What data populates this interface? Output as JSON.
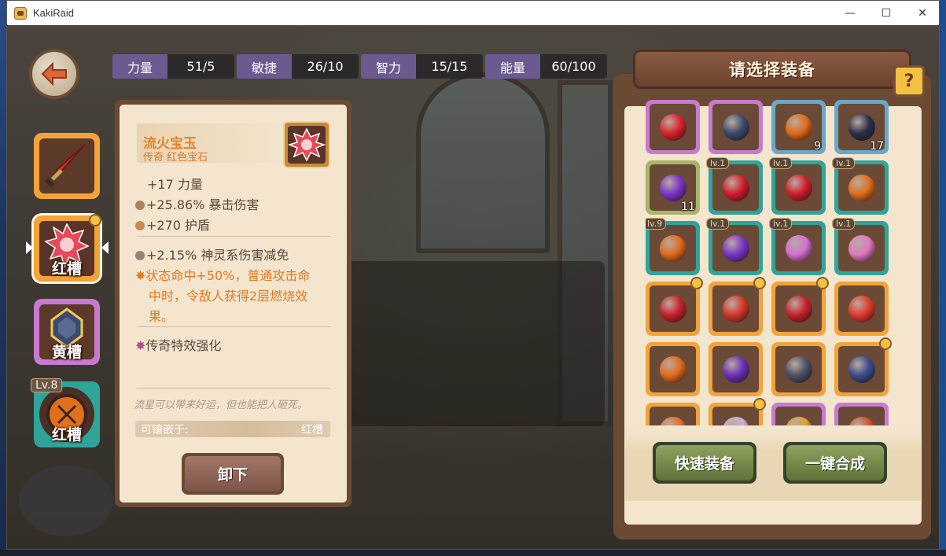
{
  "window": {
    "title": "KakiRaid",
    "minimize": "—",
    "maximize": "☐",
    "close": "✕"
  },
  "stats": [
    {
      "label": "力量",
      "value": "51/5"
    },
    {
      "label": "敏捷",
      "value": "26/10"
    },
    {
      "label": "智力",
      "value": "15/15"
    },
    {
      "label": "能量",
      "value": "60/100"
    }
  ],
  "slots": [
    {
      "label": ""
    },
    {
      "label": "红槽"
    },
    {
      "label": "黄槽"
    },
    {
      "label": "红槽",
      "level": "Lv.8"
    }
  ],
  "detail": {
    "name": "流火宝玉",
    "subtitle": "传奇 红色宝石",
    "stat1": "+17 力量",
    "stat2": "+25.86% 暴击伤害",
    "stat3": "+270 护盾",
    "stat4": "+2.15% 神灵系伤害减免",
    "effect_lines": [
      "状态命中+50%，普通攻击命",
      "中时，令敌人获得2层燃烧效",
      "果。"
    ],
    "legend_effect": "传奇特效强化",
    "flavor": "流星可以带来好运，但也能把人砸死。",
    "socket_label": "可镶嵌于:",
    "socket_value": "红槽",
    "unequip": "卸下"
  },
  "right_panel": {
    "title": "请选择装备",
    "help": "?",
    "quick_equip": "快速装备",
    "one_click_merge": "一键合成",
    "items": [
      {
        "frame": "#c77bd0",
        "gem": "#d9232b",
        "count": "",
        "level": "",
        "wrench": false
      },
      {
        "frame": "#c77bd0",
        "gem": "#3b4a6b",
        "count": "",
        "level": "",
        "wrench": false
      },
      {
        "frame": "#6aa7c9",
        "gem": "#e06a1b",
        "count": "9",
        "level": "",
        "wrench": false
      },
      {
        "frame": "#6aa7c9",
        "gem": "#2a2f4a",
        "count": "17",
        "level": "",
        "wrench": false
      },
      {
        "frame": "#a9b36a",
        "gem": "#7a34c8",
        "count": "11",
        "level": "",
        "wrench": false
      },
      {
        "frame": "#2fa59a",
        "gem": "#d01e2a",
        "count": "",
        "level": "lv.1",
        "wrench": false
      },
      {
        "frame": "#2fa59a",
        "gem": "#d01e2a",
        "count": "",
        "level": "lv.1",
        "wrench": false
      },
      {
        "frame": "#2fa59a",
        "gem": "#e0701b",
        "count": "",
        "level": "lv.1",
        "wrench": false
      },
      {
        "frame": "#2fa59a",
        "gem": "#e06a1b",
        "count": "",
        "level": "lv.9",
        "wrench": false
      },
      {
        "frame": "#2fa59a",
        "gem": "#7a34c8",
        "count": "",
        "level": "lv.1",
        "wrench": false
      },
      {
        "frame": "#2fa59a",
        "gem": "#d46fd0",
        "count": "",
        "level": "lv.1",
        "wrench": false
      },
      {
        "frame": "#2fa59a",
        "gem": "#e07ac0",
        "count": "",
        "level": "lv.1",
        "wrench": false
      },
      {
        "frame": "#f2a33a",
        "gem": "#c8202a",
        "count": "",
        "level": "",
        "wrench": true
      },
      {
        "frame": "#f2a33a",
        "gem": "#d4382a",
        "count": "",
        "level": "",
        "wrench": true
      },
      {
        "frame": "#f2a33a",
        "gem": "#c8202a",
        "count": "",
        "level": "",
        "wrench": true
      },
      {
        "frame": "#f2a33a",
        "gem": "#e03a2a",
        "count": "",
        "level": "",
        "wrench": false
      },
      {
        "frame": "#f2a33a",
        "gem": "#e26a1b",
        "count": "",
        "level": "",
        "wrench": false
      },
      {
        "frame": "#f2a33a",
        "gem": "#6a2fb8",
        "count": "",
        "level": "",
        "wrench": false
      },
      {
        "frame": "#f2a33a",
        "gem": "#4a5064",
        "count": "",
        "level": "",
        "wrench": false
      },
      {
        "frame": "#f2a33a",
        "gem": "#3a4a8a",
        "count": "",
        "level": "",
        "wrench": true
      },
      {
        "frame": "#f2a33a",
        "gem": "#e07030",
        "count": "",
        "level": "",
        "wrench": false
      },
      {
        "frame": "#f2a33a",
        "gem": "#c8b0d8",
        "count": "",
        "level": "",
        "wrench": true
      },
      {
        "frame": "#c77bd0",
        "gem": "#e0a030",
        "count": "",
        "level": "",
        "wrench": false
      },
      {
        "frame": "#c77bd0",
        "gem": "#d05030",
        "count": "",
        "level": "",
        "wrench": false
      }
    ]
  }
}
